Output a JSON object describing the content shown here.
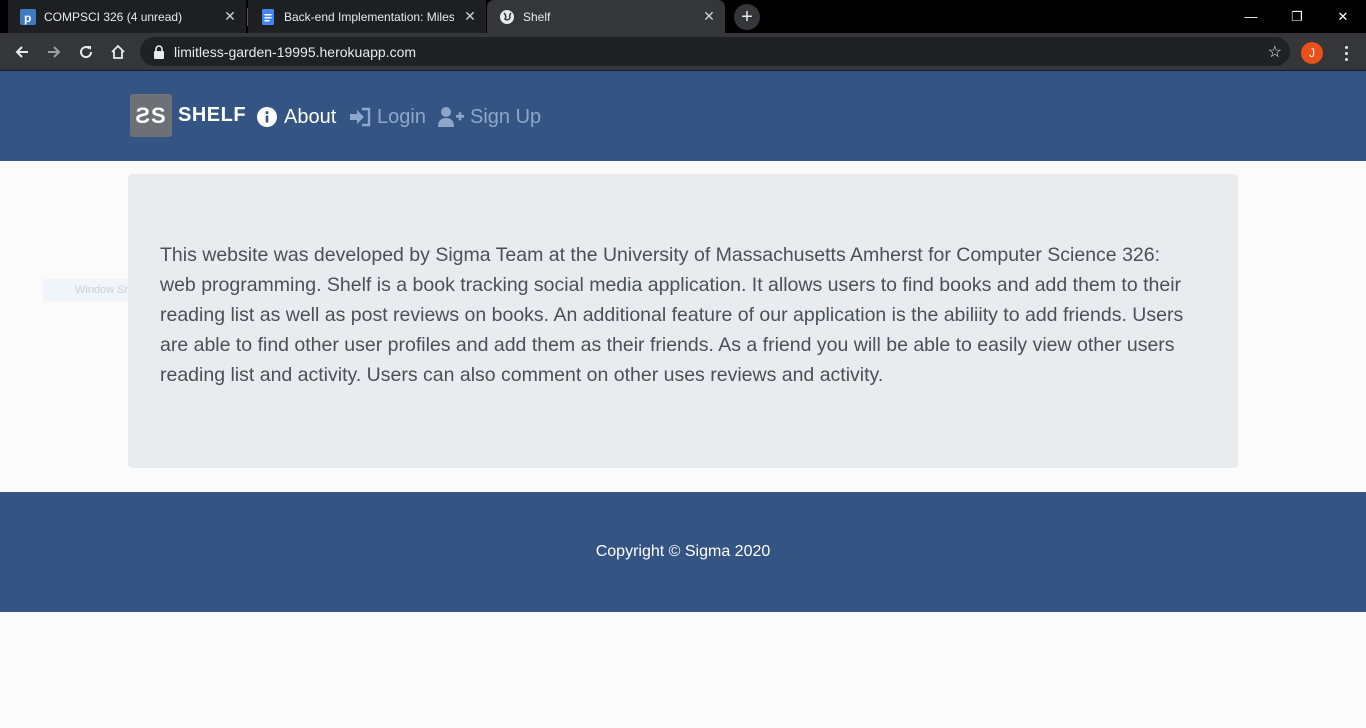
{
  "browser": {
    "tabs": [
      {
        "title": "COMPSCI 326 (4 unread)",
        "icon": "piazza-icon",
        "active": false
      },
      {
        "title": "Back-end Implementation: Milest",
        "icon": "docs-icon",
        "active": false
      },
      {
        "title": "Shelf",
        "icon": "globe-icon",
        "active": true
      }
    ],
    "close_glyph": "✕",
    "newtab_glyph": "+",
    "window_controls": {
      "minimize": "—",
      "restore": "❐",
      "close": "✕"
    },
    "url": "limitless-garden-19995.herokuapp.com",
    "profile_initial": "J"
  },
  "site": {
    "brand_logo": "ƧS",
    "brand_name": "SHELF",
    "nav": [
      {
        "label": "About",
        "icon": "info-icon"
      },
      {
        "label": "Login",
        "icon": "sign-in-icon"
      },
      {
        "label": "Sign Up",
        "icon": "user-plus-icon"
      }
    ],
    "about_text": "This website was developed by Sigma Team at the University of Massachusetts Amherst for Computer Science 326: web programming. Shelf is a book tracking social media application. It allows users to find books and add them to their reading list as well as post reviews on books. An additional feature of our application is the abiliity to add friends. Users are able to find other user profiles and add them as their friends. As a friend you will be able to easily view other users reading list and activity. Users can also comment on other uses reviews and activity.",
    "footer": "Copyright © Sigma 2020",
    "ghost_label": "Window Snip"
  },
  "colors": {
    "navbar": "#345584",
    "jumbotron": "#e9ecef",
    "nav_muted": "#8ea6c8"
  }
}
